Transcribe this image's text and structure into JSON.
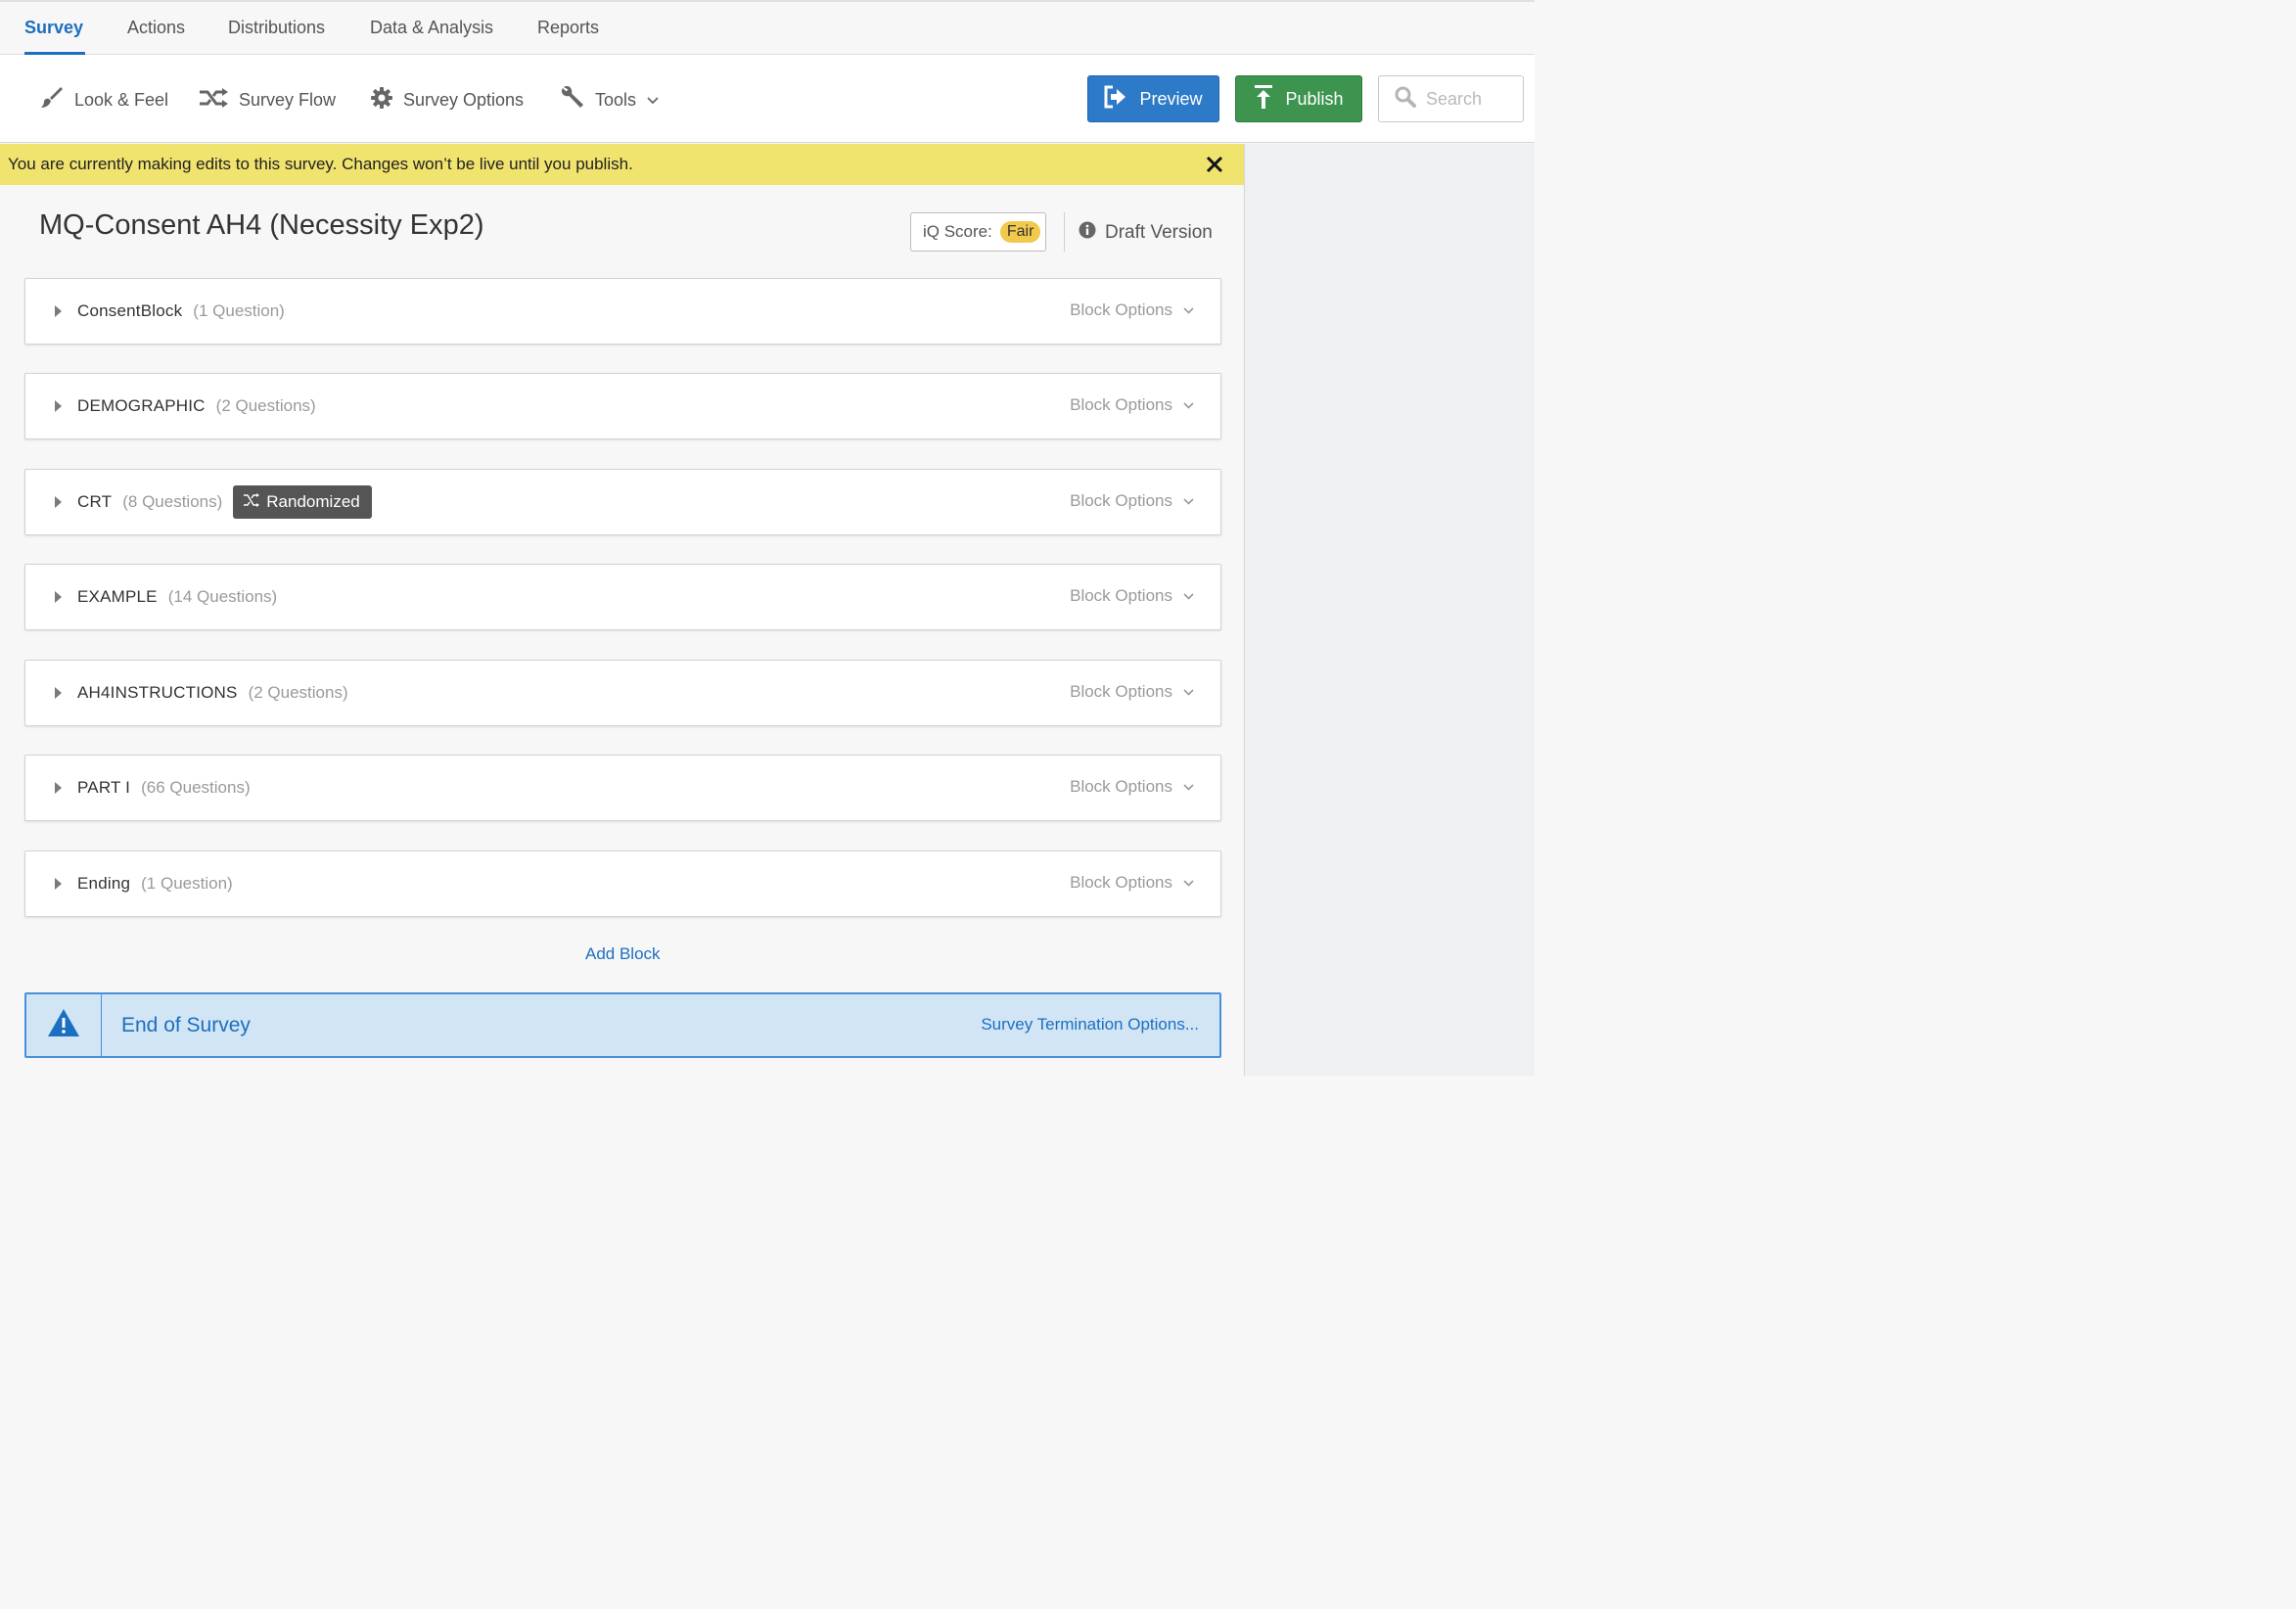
{
  "tabs": [
    {
      "label": "Survey",
      "active": true
    },
    {
      "label": "Actions",
      "active": false
    },
    {
      "label": "Distributions",
      "active": false
    },
    {
      "label": "Data & Analysis",
      "active": false
    },
    {
      "label": "Reports",
      "active": false
    }
  ],
  "toolbar": {
    "look_feel": "Look & Feel",
    "survey_flow": "Survey Flow",
    "survey_options": "Survey Options",
    "tools": "Tools",
    "preview": "Preview",
    "publish": "Publish",
    "search_placeholder": "Search"
  },
  "banner": {
    "message": "You are currently making edits to this survey. Changes won’t be live until you publish."
  },
  "survey": {
    "title": "MQ-Consent AH4 (Necessity Exp2)",
    "iq_score_label": "iQ Score:",
    "iq_score_value": "Fair",
    "version": "Draft Version"
  },
  "blocks": [
    {
      "name": "ConsentBlock",
      "count": "(1 Question)",
      "options": "Block Options"
    },
    {
      "name": "DEMOGRAPHIC",
      "count": "(2 Questions)",
      "options": "Block Options"
    },
    {
      "name": "CRT",
      "count": "(8 Questions)",
      "badge": "Randomized",
      "options": "Block Options"
    },
    {
      "name": "EXAMPLE",
      "count": "(14 Questions)",
      "options": "Block Options"
    },
    {
      "name": "AH4INSTRUCTIONS",
      "count": "(2 Questions)",
      "options": "Block Options"
    },
    {
      "name": "PART I",
      "count": "(66 Questions)",
      "options": "Block Options"
    },
    {
      "name": "Ending",
      "count": "(1 Question)",
      "options": "Block Options"
    }
  ],
  "add_block": "Add Block",
  "end_of_survey": {
    "title": "End of Survey",
    "options_link": "Survey Termination Options..."
  },
  "colors": {
    "accent_blue": "#1b6fc0",
    "preview_button": "#2c7ac8",
    "publish_button": "#3d944f",
    "banner_yellow": "#f0e36e",
    "iq_badge": "#f2c94c",
    "end_of_survey_bg": "#d2e5f5"
  }
}
